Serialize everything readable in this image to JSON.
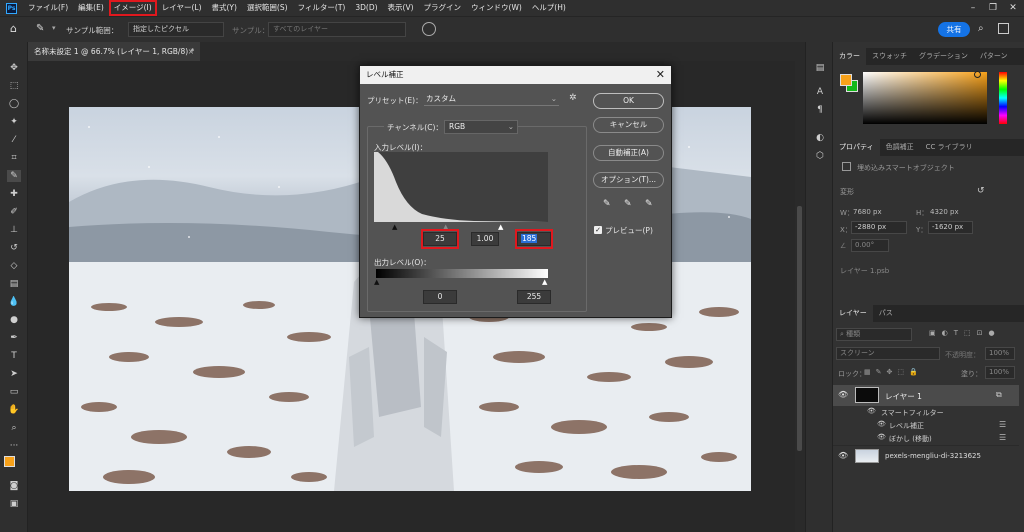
{
  "menu": {
    "logo": "Ps",
    "items": [
      "ファイル(F)",
      "編集(E)",
      "イメージ(I)",
      "レイヤー(L)",
      "書式(Y)",
      "選択範囲(S)",
      "フィルター(T)",
      "3D(D)",
      "表示(V)",
      "プラグイン",
      "ウィンドウ(W)",
      "ヘルプ(H)"
    ],
    "highlighted_index": 2
  },
  "options_bar": {
    "sample_size_label": "サンプル範囲：",
    "sample_size_value": "指定したピクセル",
    "sample_label": "サンプル：",
    "sample_value": "すべてのレイヤー",
    "share_label": "共有"
  },
  "document_tab": {
    "title": "名称未設定 1 @ 66.7% (レイヤー 1, RGB/8) *",
    "close": "×"
  },
  "dialog": {
    "title": "レベル補正",
    "preset_label": "プリセット(E)：",
    "preset_value": "カスタム",
    "channel_label": "チャンネル(C)：",
    "channel_value": "RGB",
    "input_levels_label": "入力レベル(I)：",
    "output_levels_label": "出力レベル(O)：",
    "input_black": "25",
    "input_gamma": "1.00",
    "input_white": "185",
    "output_black": "0",
    "output_white": "255",
    "ok_label": "OK",
    "cancel_label": "キャンセル",
    "auto_label": "自動補正(A)",
    "options_label": "オプション(T)...",
    "preview_label": "プレビュー(P)",
    "preview_checked": true,
    "highlight_color": "#e0181e"
  },
  "color_panel": {
    "tabs": [
      "カラー",
      "スウォッチ",
      "グラデーション",
      "パターン"
    ],
    "foreground": "#f7a11a",
    "background": "#13b81a"
  },
  "properties_panel": {
    "tabs": [
      "プロパティ",
      "色調補正",
      "CC ライブラリ"
    ],
    "object_type": "埋め込みスマートオブジェクト",
    "transform_label": "変形",
    "w_label": "W：",
    "w_value": "7680 px",
    "h_label": "H：",
    "h_value": "4320 px",
    "x_label": "X：",
    "x_value": "-2880 px",
    "y_label": "Y：",
    "y_value": "-1620 px",
    "angle_value": "0.00°",
    "source": "レイヤー 1.psb"
  },
  "layers_panel": {
    "tabs": [
      "レイヤー",
      "パス"
    ],
    "kind_label": "種類",
    "blend_mode": "スクリーン",
    "opacity_label": "不透明度：",
    "opacity_value": "100%",
    "lock_label": "ロック：",
    "fill_label": "塗り：",
    "fill_value": "100%",
    "layers": [
      {
        "name": "レイヤー 1",
        "type": "smart"
      },
      {
        "name": "スマートフィルター",
        "type": "filter-group"
      },
      {
        "name": "レベル補正",
        "type": "filter"
      },
      {
        "name": "ぼかし (移動)",
        "type": "filter"
      },
      {
        "name": "pexels-mengliu-di-3213625",
        "type": "image"
      }
    ]
  }
}
